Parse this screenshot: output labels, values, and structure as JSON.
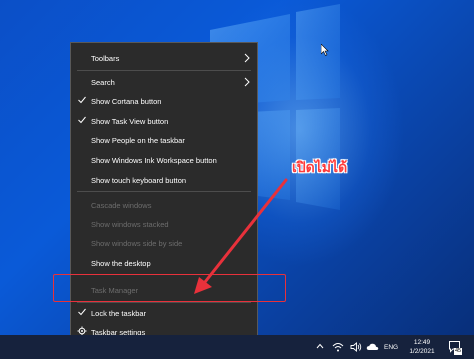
{
  "menu": {
    "items": [
      {
        "label": "Toolbars",
        "submenu": true,
        "checked": false,
        "disabled": false
      },
      {
        "label": "Search",
        "submenu": true,
        "checked": false,
        "disabled": false
      },
      {
        "label": "Show Cortana button",
        "submenu": false,
        "checked": true,
        "disabled": false
      },
      {
        "label": "Show Task View button",
        "submenu": false,
        "checked": true,
        "disabled": false
      },
      {
        "label": "Show People on the taskbar",
        "submenu": false,
        "checked": false,
        "disabled": false
      },
      {
        "label": "Show Windows Ink Workspace button",
        "submenu": false,
        "checked": false,
        "disabled": false
      },
      {
        "label": "Show touch keyboard button",
        "submenu": false,
        "checked": false,
        "disabled": false
      },
      {
        "label": "Cascade windows",
        "submenu": false,
        "checked": false,
        "disabled": true
      },
      {
        "label": "Show windows stacked",
        "submenu": false,
        "checked": false,
        "disabled": true
      },
      {
        "label": "Show windows side by side",
        "submenu": false,
        "checked": false,
        "disabled": true
      },
      {
        "label": "Show the desktop",
        "submenu": false,
        "checked": false,
        "disabled": false
      },
      {
        "label": "Task Manager",
        "submenu": false,
        "checked": false,
        "disabled": true
      },
      {
        "label": "Lock the taskbar",
        "submenu": false,
        "checked": true,
        "disabled": false
      },
      {
        "label": "Taskbar settings",
        "submenu": false,
        "checked": false,
        "disabled": false
      }
    ]
  },
  "annotation": {
    "text": "เปิดไม่ได้",
    "color": "#e8313b"
  },
  "taskbar": {
    "language": "ENG",
    "time": "12:49",
    "date": "1/2/2021",
    "notification_count": "45"
  },
  "colors": {
    "menu_bg": "#2b2b2b",
    "taskbar_bg": "#16223d",
    "desktop_blue": "#0a5ad8"
  },
  "icons": [
    "windows-logo",
    "mouse-cursor",
    "checkmark-icon",
    "chevron-right-icon",
    "chevron-up-icon",
    "network-icon",
    "volume-icon",
    "cloud-icon",
    "notification-icon"
  ]
}
